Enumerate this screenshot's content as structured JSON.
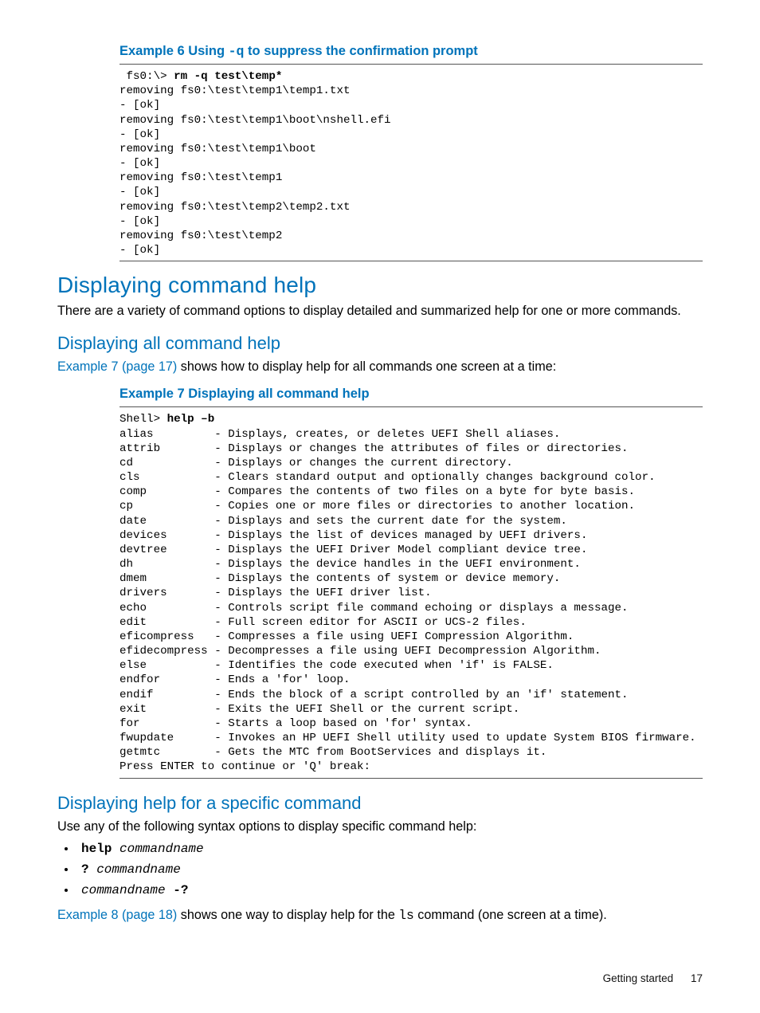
{
  "example6": {
    "title_prefix": "Example 6 Using ",
    "title_code": "-q",
    "title_suffix": " to suppress the confirmation prompt",
    "prompt": " fs0:\\> ",
    "cmd": "rm -q test\\temp*",
    "output": "removing fs0:\\test\\temp1\\temp1.txt\n- [ok]\nremoving fs0:\\test\\temp1\\boot\\nshell.efi\n- [ok]\nremoving fs0:\\test\\temp1\\boot\n- [ok]\nremoving fs0:\\test\\temp1\n- [ok]\nremoving fs0:\\test\\temp2\\temp2.txt\n- [ok]\nremoving fs0:\\test\\temp2\n- [ok]"
  },
  "sec_displaying_command_help": {
    "heading": "Displaying command help",
    "para": "There are a variety of command options to display detailed and summarized help for one or more commands."
  },
  "sec_displaying_all": {
    "heading": "Displaying all command help",
    "link_text": "Example 7 (page 17)",
    "para_tail": " shows how to display help for all commands one screen at a time:"
  },
  "example7": {
    "title": "Example 7 Displaying all command help",
    "prompt": "Shell> ",
    "cmd": "help –b",
    "rows": [
      [
        "alias",
        "Displays, creates, or deletes UEFI Shell aliases."
      ],
      [
        "attrib",
        "Displays or changes the attributes of files or directories."
      ],
      [
        "cd",
        "Displays or changes the current directory."
      ],
      [
        "cls",
        "Clears standard output and optionally changes background color."
      ],
      [
        "comp",
        "Compares the contents of two files on a byte for byte basis."
      ],
      [
        "cp",
        "Copies one or more files or directories to another location."
      ],
      [
        "date",
        "Displays and sets the current date for the system."
      ],
      [
        "devices",
        "Displays the list of devices managed by UEFI drivers."
      ],
      [
        "devtree",
        "Displays the UEFI Driver Model compliant device tree."
      ],
      [
        "dh",
        "Displays the device handles in the UEFI environment."
      ],
      [
        "dmem",
        "Displays the contents of system or device memory."
      ],
      [
        "drivers",
        "Displays the UEFI driver list."
      ],
      [
        "echo",
        "Controls script file command echoing or displays a message."
      ],
      [
        "edit",
        "Full screen editor for ASCII or UCS-2 files."
      ],
      [
        "eficompress",
        "Compresses a file using UEFI Compression Algorithm."
      ],
      [
        "efidecompress",
        "Decompresses a file using UEFI Decompression Algorithm."
      ],
      [
        "else",
        "Identifies the code executed when 'if' is FALSE."
      ],
      [
        "endfor",
        "Ends a 'for' loop."
      ],
      [
        "endif",
        "Ends the block of a script controlled by an 'if' statement."
      ],
      [
        "exit",
        "Exits the UEFI Shell or the current script."
      ],
      [
        "for",
        "Starts a loop based on 'for' syntax."
      ],
      [
        "fwupdate",
        "Invokes an HP UEFI Shell utility used to update System BIOS firmware."
      ],
      [
        "getmtc",
        "Gets the MTC from BootServices and displays it."
      ]
    ],
    "footer_line": "Press ENTER to continue or 'Q' break:"
  },
  "sec_displaying_specific": {
    "heading": "Displaying help for a specific command",
    "para": "Use any of the following syntax options to display specific command help:",
    "items": [
      {
        "prefix_bold": "help ",
        "italic": "commandname",
        "suffix": ""
      },
      {
        "prefix_bold": "? ",
        "italic": "commandname",
        "suffix": ""
      },
      {
        "prefix_bold": "",
        "italic": "commandname",
        "suffix": " -?"
      }
    ],
    "after_link_text": "Example 8 (page 18)",
    "after_para_mid": " shows one way to display help for the ",
    "after_code": "ls",
    "after_para_tail": " command (one screen at a time)."
  },
  "footer": {
    "label": "Getting started",
    "page": "17"
  }
}
